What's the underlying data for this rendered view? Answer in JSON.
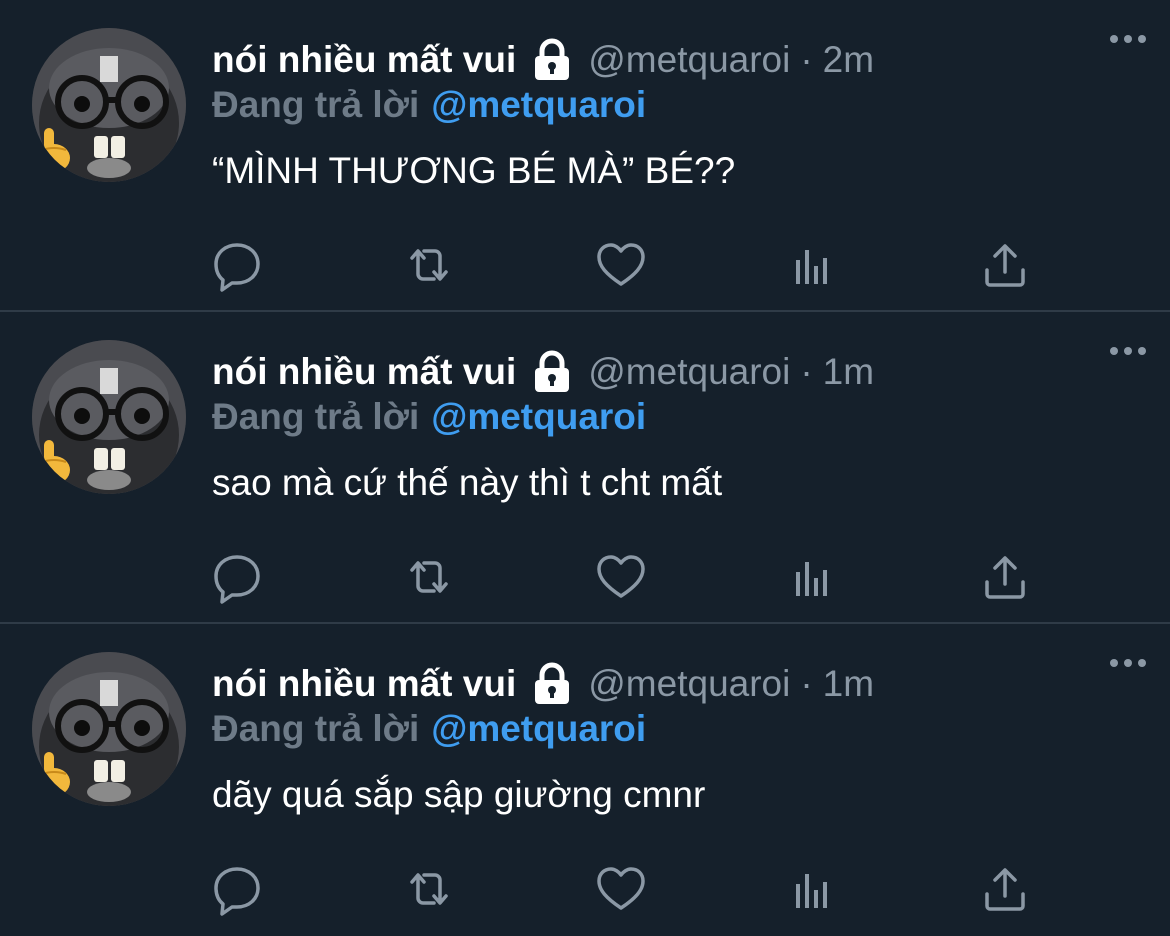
{
  "colors": {
    "background": "#15202b",
    "divider": "#2f3b47",
    "name": "#ffffff",
    "muted": "#8b98a5",
    "reply_prefix": "#6e7b88",
    "mention": "#3f9df0",
    "icon": "#8b98a5"
  },
  "tweets": [
    {
      "display_name": "nói nhiều mất vui",
      "handle": "@metquaroi",
      "separator": "·",
      "time": "2m",
      "reply_prefix": "Đang trả lời",
      "reply_to": "@metquaroi",
      "text": "“MÌNH THƯƠNG BÉ MÀ” BÉ??",
      "icons": [
        "lock-icon",
        "more-icon",
        "reply-icon",
        "retweet-icon",
        "like-icon",
        "analytics-icon",
        "share-icon"
      ]
    },
    {
      "display_name": "nói nhiều mất vui",
      "handle": "@metquaroi",
      "separator": "·",
      "time": "1m",
      "reply_prefix": "Đang trả lời",
      "reply_to": "@metquaroi",
      "text": "sao mà cứ thế này thì t cht mất",
      "icons": [
        "lock-icon",
        "more-icon",
        "reply-icon",
        "retweet-icon",
        "like-icon",
        "analytics-icon",
        "share-icon"
      ]
    },
    {
      "display_name": "nói nhiều mất vui",
      "handle": "@metquaroi",
      "separator": "·",
      "time": "1m",
      "reply_prefix": "Đang trả lời",
      "reply_to": "@metquaroi",
      "text": "dãy quá sắp sập giường cmnr",
      "icons": [
        "lock-icon",
        "more-icon",
        "reply-icon",
        "retweet-icon",
        "like-icon",
        "analytics-icon",
        "share-icon"
      ]
    }
  ]
}
